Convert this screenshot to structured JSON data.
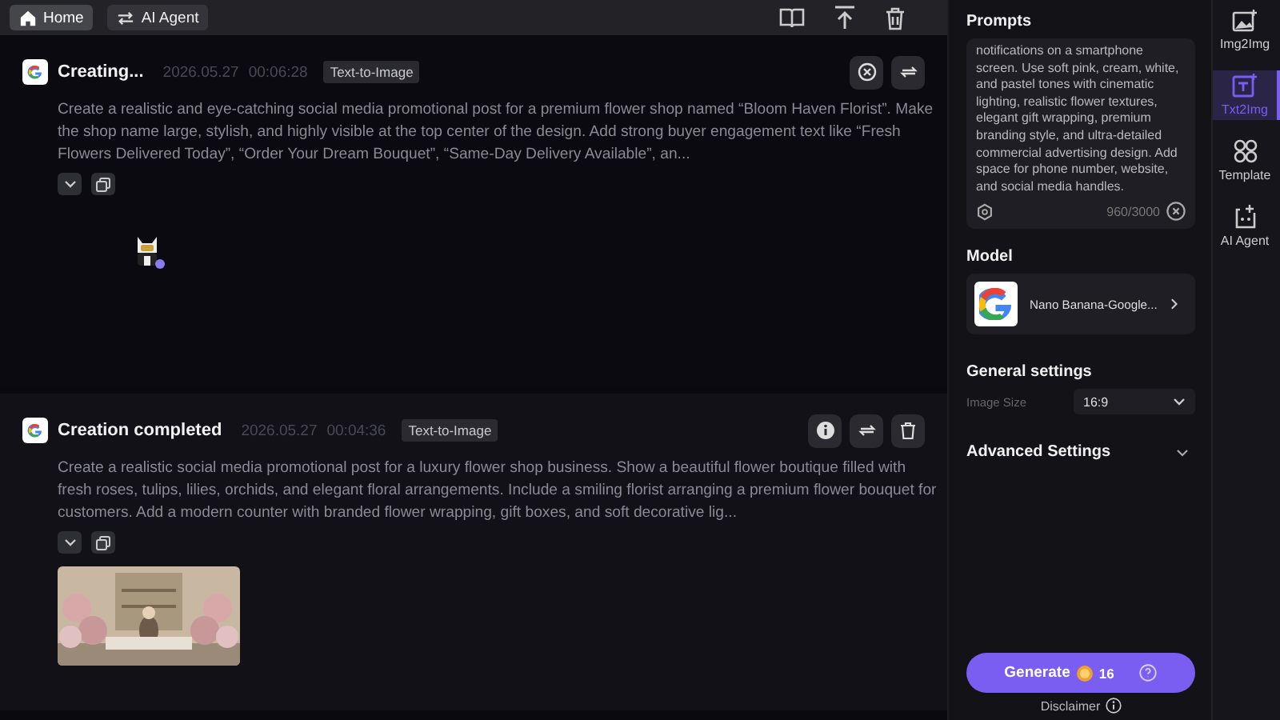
{
  "top_bar": {
    "tabs": [
      {
        "label": "Home",
        "selected": true
      },
      {
        "label": "AI Agent",
        "selected": false
      }
    ]
  },
  "tasks": [
    {
      "kind": "creating",
      "title": "Creating...",
      "date": "2026.05.27",
      "time": "00:06:28",
      "tag": "Text-to-Image",
      "prompt": "Create a realistic and eye-catching social media promotional post for a premium flower shop named “Bloom Haven Florist”. Make the shop name large, stylish, and highly visible at the top center of the design. Add strong buyer engagement text like “Fresh Flowers Delivered Today”, “Order Your Dream Bouquet”, “Same-Day Delivery Available”, an..."
    },
    {
      "kind": "completed",
      "title": "Creation completed",
      "date": "2026.05.27",
      "time": "00:04:36",
      "tag": "Text-to-Image",
      "prompt": "Create a realistic social media promotional post for a luxury flower shop business. Show a beautiful flower boutique filled with fresh roses, tulips, lilies, orchids, and elegant floral arrangements. Include a smiling florist arranging a premium flower bouquet for customers. Add a modern counter with branded flower wrapping, gift boxes, and soft decorative lig..."
    }
  ],
  "panel": {
    "prompts_title": "Prompts",
    "prompt_text": "notifications on a smartphone screen. Use soft pink, cream, white, and pastel tones with cinematic lighting, realistic flower textures, elegant gift wrapping, premium branding style, and ultra-detailed commercial advertising design. Add space for phone number, website, and social media handles.",
    "char_count": "960/3000",
    "model_title": "Model",
    "model_name": "Nano Banana-Google...",
    "general_title": "General settings",
    "image_size_label": "Image Size",
    "image_size_value": "16:9",
    "advanced_title": "Advanced Settings",
    "advanced_expanded": false,
    "generate_label": "Generate",
    "cost": "16",
    "disclaimer": "Disclaimer"
  },
  "rail": [
    {
      "label": "Img2Img",
      "selected": false
    },
    {
      "label": "Txt2Img",
      "selected": true
    },
    {
      "label": "Template",
      "selected": false
    },
    {
      "label": "AI Agent",
      "selected": false
    }
  ]
}
